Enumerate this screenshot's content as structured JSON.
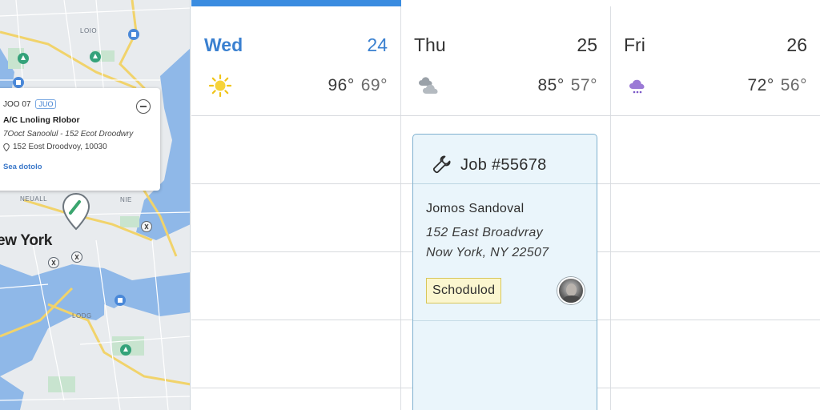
{
  "map": {
    "city_label": "ew York",
    "labels": [
      "LOIO",
      "NEUALL",
      "NIE",
      "LODG"
    ],
    "info_card": {
      "id": "JOO 07",
      "tag": "JUO",
      "title": "A/C Lnoling Rlobor",
      "address": "7Ooct Sanoolul - 152 Ecot Droodwry",
      "location": "152 Eost Droodvoy, 10030",
      "link": "Sea dotolo"
    }
  },
  "calendar": {
    "accent_color": "#3a8ce0",
    "days": [
      {
        "name": "Wed",
        "date": "24",
        "icon": "sunny-icon",
        "high": "96°",
        "low": "69°",
        "active": true
      },
      {
        "name": "Thu",
        "date": "25",
        "icon": "cloudy-icon",
        "high": "85°",
        "low": "57°",
        "active": false
      },
      {
        "name": "Fri",
        "date": "26",
        "icon": "rain-cloud-icon",
        "high": "72°",
        "low": "56°",
        "active": false
      }
    ],
    "job": {
      "title": "Job #55678",
      "customer": "Jomos Sandoval",
      "address_line1": "152 East Broadvray",
      "address_line2": "Now York, NY 22507",
      "status": "Schodulod",
      "status_color": "#fbf6cf",
      "icon": "wrench-icon"
    }
  }
}
